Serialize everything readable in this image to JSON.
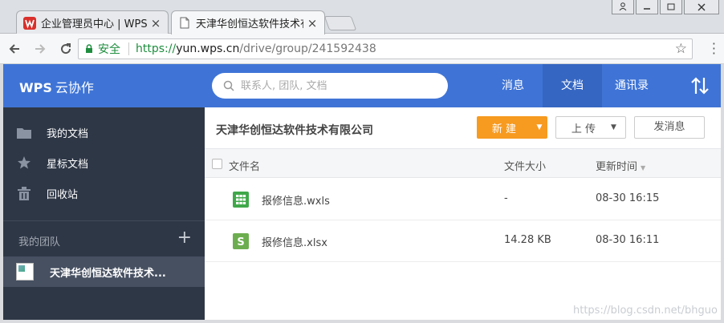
{
  "browser": {
    "tabs": [
      {
        "title": "企业管理员中心 | WPS+",
        "icon": "wps-logo-icon",
        "active": false
      },
      {
        "title": "天津华创恒达软件技术有",
        "icon": "document-icon",
        "active": true
      }
    ],
    "secure_label": "安全",
    "url_scheme": "https://",
    "url_host": "yun.wps.cn",
    "url_path": "/drive/group/241592438"
  },
  "app": {
    "logo": "WPS",
    "logo_sub": "云协作",
    "search_placeholder": "联系人, 团队, 文档",
    "nav": [
      "消息",
      "文档",
      "通讯录"
    ],
    "active_nav": "文档",
    "accent_color": "#3f74d6"
  },
  "sidebar": {
    "items": [
      {
        "label": "我的文档",
        "icon": "folder-icon"
      },
      {
        "label": "星标文档",
        "icon": "star-icon"
      },
      {
        "label": "回收站",
        "icon": "trash-icon"
      }
    ],
    "team_header": "我的团队",
    "team_item": "天津华创恒达软件技术..."
  },
  "main": {
    "group_title": "天津华创恒达软件技术有限公司",
    "new_button": "新 建",
    "upload_button": "上 传",
    "message_button": "发消息",
    "columns": {
      "name": "文件名",
      "size": "文件大小",
      "updated": "更新时间"
    },
    "files": [
      {
        "name": "报修信息.wxls",
        "size": "-",
        "updated": "08-30 16:15",
        "icon": "table-app-icon"
      },
      {
        "name": "报修信息.xlsx",
        "size": "14.28 KB",
        "updated": "08-30 16:11",
        "icon": "spreadsheet-s-icon"
      }
    ]
  },
  "watermark": "https://blog.csdn.net/bhguo"
}
